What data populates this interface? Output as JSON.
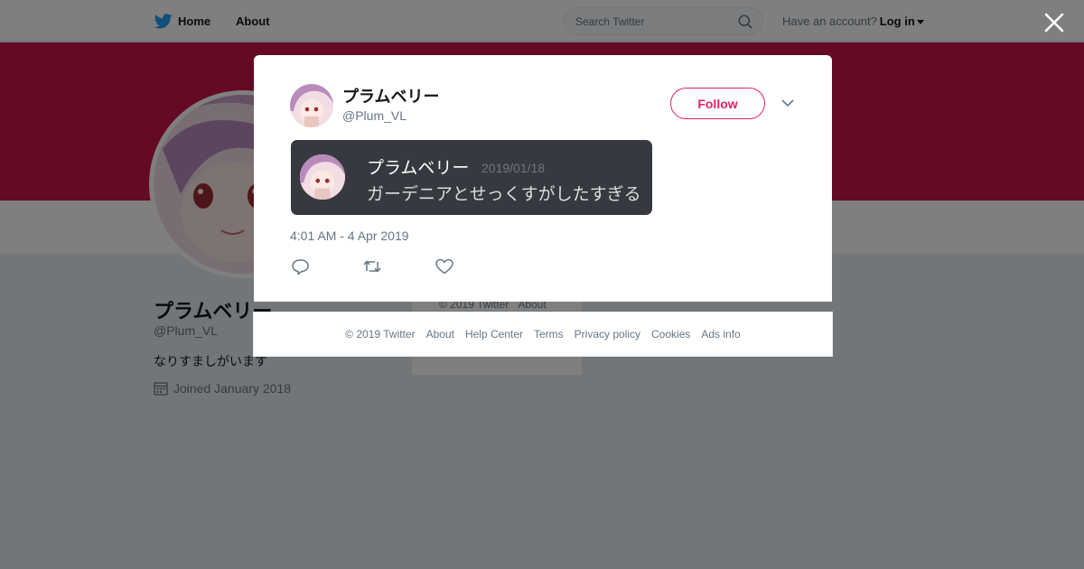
{
  "nav": {
    "home_label": "Home",
    "about_label": "About",
    "search_placeholder": "Search Twitter",
    "account_prompt": "Have an account?",
    "login_label": "Log in"
  },
  "profile": {
    "name": "プラムベリー",
    "handle": "@Plum_VL",
    "bio": "なりすましがいます",
    "joined": "Joined January 2018"
  },
  "side_footer": {
    "copyright": "© 2019 Twitter",
    "about": "About"
  },
  "tweet": {
    "author_name": "プラムベリー",
    "author_handle": "@Plum_VL",
    "follow_label": "Follow",
    "embed": {
      "name": "プラムベリー",
      "date": "2019/01/18",
      "text": "ガーデニアとせっくすがしたすぎる"
    },
    "timestamp": "4:01 AM - 4 Apr 2019"
  },
  "footer": {
    "links": [
      "© 2019 Twitter",
      "About",
      "Help Center",
      "Terms",
      "Privacy policy",
      "Cookies",
      "Ads info"
    ]
  },
  "colors": {
    "banner": "#c8154a",
    "follow_accent": "#e0245e",
    "twitter_blue": "#1da1f2",
    "embed_bg": "#36393f"
  }
}
